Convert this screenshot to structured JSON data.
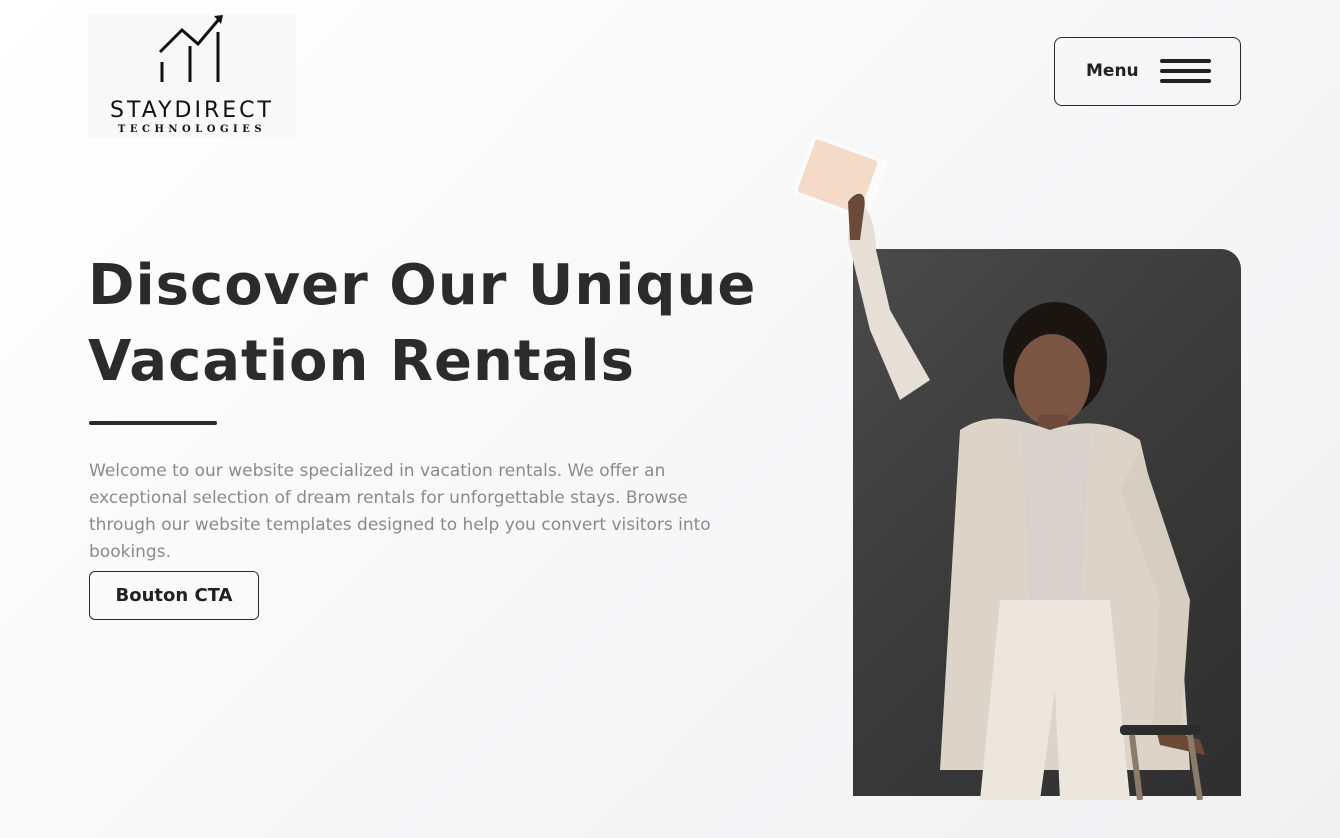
{
  "header": {
    "logo": {
      "wordmark": "STAYDIRECT",
      "tagline": "TECHNOLOGIES",
      "icon": "rising-chart-icon"
    },
    "menu": {
      "label": "Menu",
      "icon": "hamburger-icon"
    }
  },
  "hero": {
    "title_line1": "Discover Our Unique",
    "title_line2": "Vacation Rentals",
    "description": "Welcome to our website specialized in vacation rentals. We offer an exceptional selection of dream rentals for unforgettable stays. Browse through our website templates designed to help you convert visitors into bookings.",
    "cta_label": "Bouton CTA",
    "image": "woman-holding-ticket-with-suitcase"
  },
  "colors": {
    "text_dark": "#2b2b2b",
    "text_muted": "#8a8a8a",
    "photo_bg": "#3d3d3d",
    "page_bg": "#f7f7f8"
  }
}
